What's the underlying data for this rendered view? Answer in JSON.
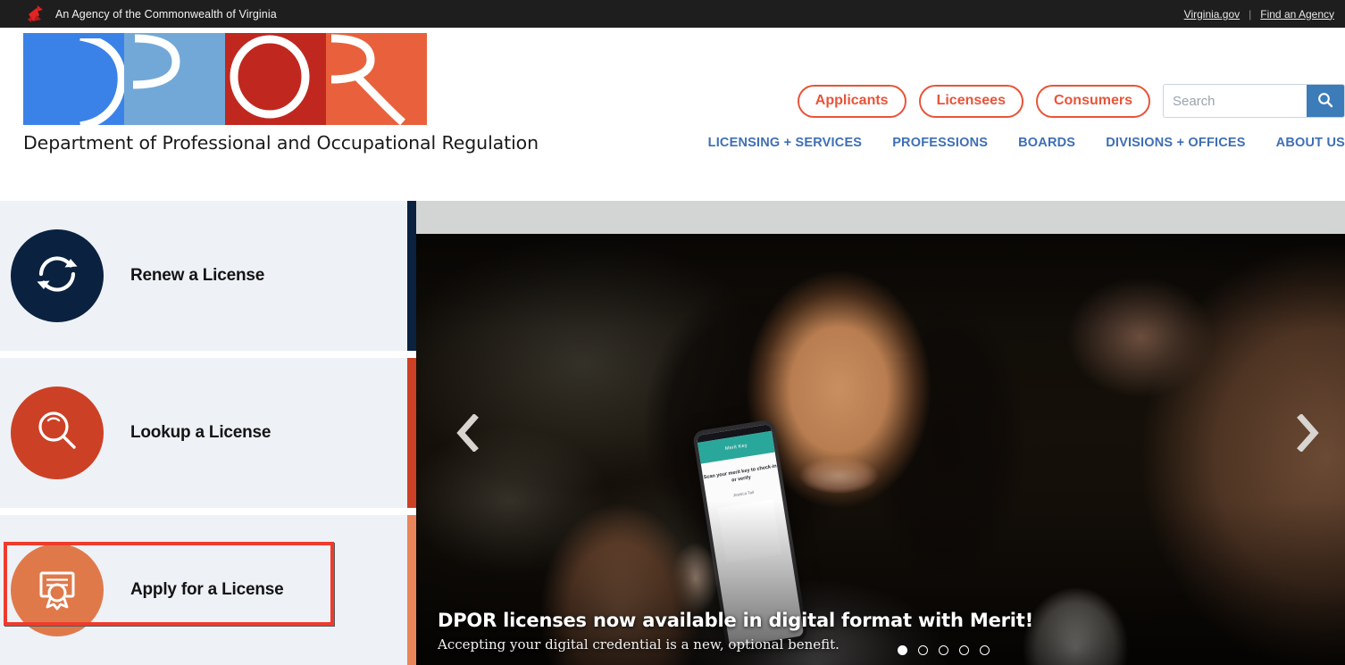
{
  "gov_bar": {
    "flag_icon": "virginia-cardinal-icon",
    "agency_text": "An Agency of the Commonwealth of Virginia",
    "links": [
      {
        "label": "Virginia.gov"
      },
      {
        "label": "Find an Agency"
      }
    ],
    "separator": "|"
  },
  "header": {
    "logo": {
      "letters": [
        "D",
        "P",
        "O",
        "R"
      ],
      "colors": [
        "#3b82e8",
        "#72a8d8",
        "#c0281f",
        "#e8613c"
      ],
      "tagline": "Department of Professional and Occupational Regulation"
    },
    "audience_buttons": [
      {
        "label": "Applicants"
      },
      {
        "label": "Licensees"
      },
      {
        "label": "Consumers"
      }
    ],
    "search": {
      "placeholder": "Search",
      "value": "",
      "button_icon": "search-icon",
      "button_color": "#3c7cb8"
    },
    "nav": [
      {
        "label": "LICENSING + SERVICES"
      },
      {
        "label": "PROFESSIONS"
      },
      {
        "label": "BOARDS"
      },
      {
        "label": "DIVISIONS + OFFICES"
      },
      {
        "label": "ABOUT US"
      }
    ],
    "nav_color": "#3e6fb5"
  },
  "quick_links": [
    {
      "label": "Renew a License",
      "icon": "refresh-cycle-icon",
      "circle_color": "#0a2240",
      "accent_color": "#0a2240",
      "highlighted": false
    },
    {
      "label": "Lookup a License",
      "icon": "magnifier-icon",
      "circle_color": "#cc4125",
      "accent_color": "#cc4125",
      "highlighted": false
    },
    {
      "label": "Apply for a License",
      "icon": "certificate-award-icon",
      "circle_color": "#e0794a",
      "accent_color": "#e8855a",
      "highlighted": true
    }
  ],
  "highlight": {
    "color": "#ef3b2c"
  },
  "hero": {
    "title": "DPOR licenses now available in digital format with Merit!",
    "subtitle": "Accepting your digital credential is a new, optional benefit.",
    "prev_icon": "chevron-left-icon",
    "next_icon": "chevron-right-icon",
    "slide_count": 5,
    "active_slide": 1,
    "phone": {
      "app_title": "Merit Key",
      "prompt": "Scan your merit key to check-in or verify",
      "person": "Jessica Tait",
      "code_icon": "qr-code-icon"
    }
  }
}
